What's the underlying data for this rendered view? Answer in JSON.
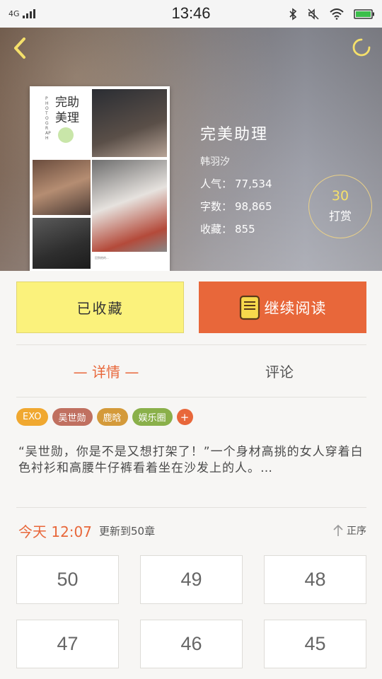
{
  "status_bar": {
    "network": "4G",
    "time": "13:46"
  },
  "book": {
    "title": "完美助理",
    "author": "韩羽汐",
    "cover_title": "完助美理",
    "cover_side_text": "PHOTOGRAPH",
    "cover_caption": "回到他的...",
    "stats": [
      {
        "label": "人气：",
        "value": "77,534"
      },
      {
        "label": "字数：",
        "value": "98,865"
      },
      {
        "label": "收藏：",
        "value": "855"
      }
    ]
  },
  "reward": {
    "count": "30",
    "label": "打赏"
  },
  "actions": {
    "favorite_label": "已收藏",
    "read_label": "继续阅读"
  },
  "tabs": {
    "detail": "— 详情 —",
    "comment": "评论"
  },
  "tags": [
    {
      "label": "EXO",
      "color": "#f0a830"
    },
    {
      "label": "吴世勋",
      "color": "#c07060"
    },
    {
      "label": "鹿晗",
      "color": "#d49a3a"
    },
    {
      "label": "娱乐圈",
      "color": "#8ab04a"
    }
  ],
  "tag_add": "+",
  "synopsis": "“吴世勋，你是不是又想打架了！”一个身材高挑的女人穿着白色衬衫和高腰牛仔裤看着坐在沙发上的人。…",
  "update": {
    "today": "今天 12:07",
    "note": "更新到50章",
    "sort_label": "正序"
  },
  "chapters": [
    "50",
    "49",
    "48",
    "47",
    "46",
    "45"
  ],
  "colors": {
    "accent": "#e8673a",
    "favorite_bg": "#fbf27c",
    "reward_num": "#f5e06b"
  },
  "icons": [
    "back-arrow-icon",
    "loading-icon",
    "book-icon",
    "sort-up-arrow-icon",
    "bluetooth-icon",
    "mute-icon",
    "wifi-icon",
    "battery-icon",
    "signal-icon"
  ]
}
